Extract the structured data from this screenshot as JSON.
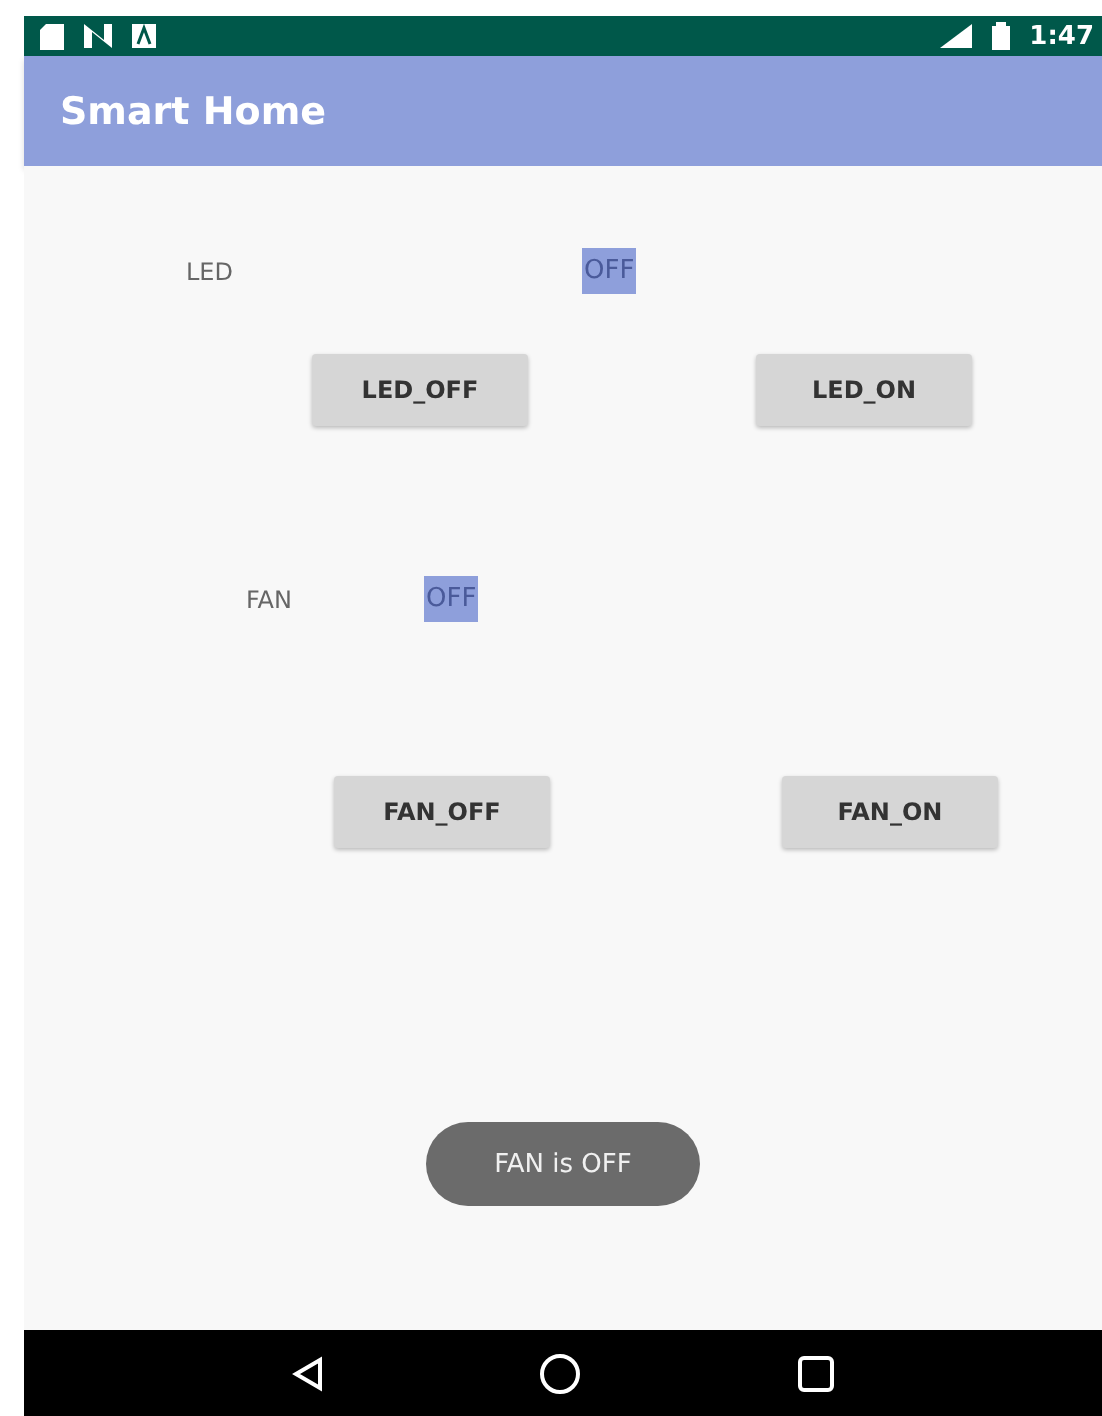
{
  "status_bar": {
    "time": "1:47"
  },
  "app_bar": {
    "title": "Smart Home"
  },
  "devices": [
    {
      "label": "LED",
      "status": "OFF",
      "buttons": [
        "LED_OFF",
        "LED_ON"
      ]
    },
    {
      "label": "FAN",
      "status": "OFF",
      "buttons": [
        "FAN_OFF",
        "FAN_ON"
      ]
    }
  ],
  "toast": "FAN is OFF"
}
